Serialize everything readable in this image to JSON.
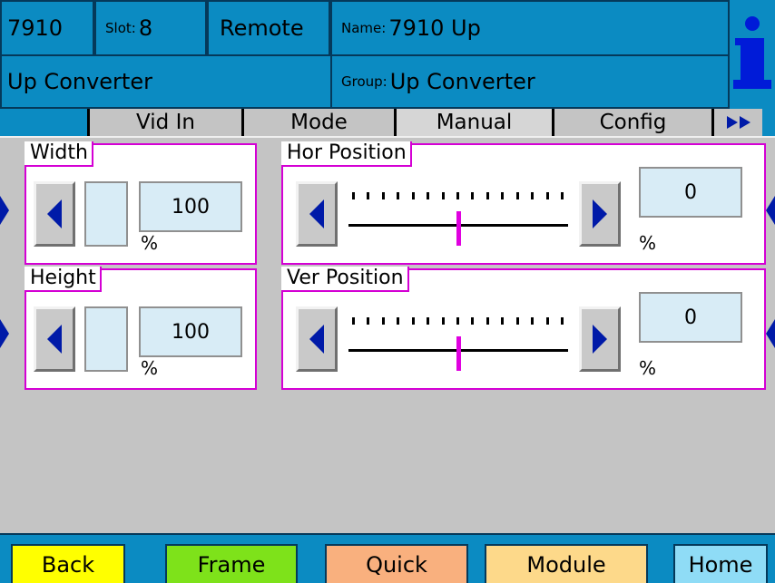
{
  "header": {
    "model": "7910",
    "slot_label": "Slot:",
    "slot_value": "8",
    "mode": "Remote",
    "name_label": "Name:",
    "name_value": "7910 Up",
    "device_type": "Up Converter",
    "group_label": "Group:",
    "group_value": "Up Converter",
    "info_icon": "info-icon"
  },
  "tabs": [
    {
      "label": "Vid In"
    },
    {
      "label": "Mode"
    },
    {
      "label": "Manual"
    },
    {
      "label": "Config"
    }
  ],
  "tabs_more_icon": "double-chevron-right-icon",
  "controls": {
    "width": {
      "label": "Width",
      "value": "100",
      "unit": "%"
    },
    "height": {
      "label": "Height",
      "value": "100",
      "unit": "%"
    },
    "hor_position": {
      "label": "Hor Position",
      "value": "0",
      "unit": "%",
      "level": 0.5
    },
    "ver_position": {
      "label": "Ver Position",
      "value": "0",
      "unit": "%",
      "level": 0.5
    }
  },
  "nav": {
    "back": "Back",
    "frame": "Frame",
    "quick": "Quick",
    "module": "Module",
    "home": "Home"
  },
  "colors": {
    "header_bg": "#0b8bc2",
    "accent_arrow": "#001aa8",
    "panel_border": "#d400d4",
    "back_btn": "#ffff00",
    "frame_btn": "#7ee21a",
    "quick_btn": "#f9b07e",
    "module_btn": "#fdd98a",
    "home_btn": "#8fdcf6"
  }
}
